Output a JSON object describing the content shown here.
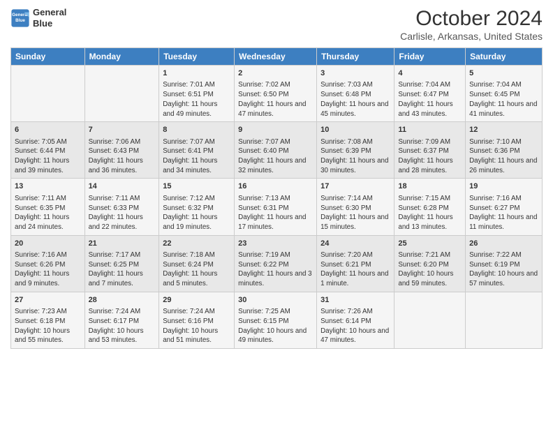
{
  "logo": {
    "line1": "General",
    "line2": "Blue"
  },
  "title": "October 2024",
  "subtitle": "Carlisle, Arkansas, United States",
  "days_of_week": [
    "Sunday",
    "Monday",
    "Tuesday",
    "Wednesday",
    "Thursday",
    "Friday",
    "Saturday"
  ],
  "weeks": [
    [
      {
        "day": "",
        "info": ""
      },
      {
        "day": "",
        "info": ""
      },
      {
        "day": "1",
        "info": "Sunrise: 7:01 AM\nSunset: 6:51 PM\nDaylight: 11 hours and 49 minutes."
      },
      {
        "day": "2",
        "info": "Sunrise: 7:02 AM\nSunset: 6:50 PM\nDaylight: 11 hours and 47 minutes."
      },
      {
        "day": "3",
        "info": "Sunrise: 7:03 AM\nSunset: 6:48 PM\nDaylight: 11 hours and 45 minutes."
      },
      {
        "day": "4",
        "info": "Sunrise: 7:04 AM\nSunset: 6:47 PM\nDaylight: 11 hours and 43 minutes."
      },
      {
        "day": "5",
        "info": "Sunrise: 7:04 AM\nSunset: 6:45 PM\nDaylight: 11 hours and 41 minutes."
      }
    ],
    [
      {
        "day": "6",
        "info": "Sunrise: 7:05 AM\nSunset: 6:44 PM\nDaylight: 11 hours and 39 minutes."
      },
      {
        "day": "7",
        "info": "Sunrise: 7:06 AM\nSunset: 6:43 PM\nDaylight: 11 hours and 36 minutes."
      },
      {
        "day": "8",
        "info": "Sunrise: 7:07 AM\nSunset: 6:41 PM\nDaylight: 11 hours and 34 minutes."
      },
      {
        "day": "9",
        "info": "Sunrise: 7:07 AM\nSunset: 6:40 PM\nDaylight: 11 hours and 32 minutes."
      },
      {
        "day": "10",
        "info": "Sunrise: 7:08 AM\nSunset: 6:39 PM\nDaylight: 11 hours and 30 minutes."
      },
      {
        "day": "11",
        "info": "Sunrise: 7:09 AM\nSunset: 6:37 PM\nDaylight: 11 hours and 28 minutes."
      },
      {
        "day": "12",
        "info": "Sunrise: 7:10 AM\nSunset: 6:36 PM\nDaylight: 11 hours and 26 minutes."
      }
    ],
    [
      {
        "day": "13",
        "info": "Sunrise: 7:11 AM\nSunset: 6:35 PM\nDaylight: 11 hours and 24 minutes."
      },
      {
        "day": "14",
        "info": "Sunrise: 7:11 AM\nSunset: 6:33 PM\nDaylight: 11 hours and 22 minutes."
      },
      {
        "day": "15",
        "info": "Sunrise: 7:12 AM\nSunset: 6:32 PM\nDaylight: 11 hours and 19 minutes."
      },
      {
        "day": "16",
        "info": "Sunrise: 7:13 AM\nSunset: 6:31 PM\nDaylight: 11 hours and 17 minutes."
      },
      {
        "day": "17",
        "info": "Sunrise: 7:14 AM\nSunset: 6:30 PM\nDaylight: 11 hours and 15 minutes."
      },
      {
        "day": "18",
        "info": "Sunrise: 7:15 AM\nSunset: 6:28 PM\nDaylight: 11 hours and 13 minutes."
      },
      {
        "day": "19",
        "info": "Sunrise: 7:16 AM\nSunset: 6:27 PM\nDaylight: 11 hours and 11 minutes."
      }
    ],
    [
      {
        "day": "20",
        "info": "Sunrise: 7:16 AM\nSunset: 6:26 PM\nDaylight: 11 hours and 9 minutes."
      },
      {
        "day": "21",
        "info": "Sunrise: 7:17 AM\nSunset: 6:25 PM\nDaylight: 11 hours and 7 minutes."
      },
      {
        "day": "22",
        "info": "Sunrise: 7:18 AM\nSunset: 6:24 PM\nDaylight: 11 hours and 5 minutes."
      },
      {
        "day": "23",
        "info": "Sunrise: 7:19 AM\nSunset: 6:22 PM\nDaylight: 11 hours and 3 minutes."
      },
      {
        "day": "24",
        "info": "Sunrise: 7:20 AM\nSunset: 6:21 PM\nDaylight: 11 hours and 1 minute."
      },
      {
        "day": "25",
        "info": "Sunrise: 7:21 AM\nSunset: 6:20 PM\nDaylight: 10 hours and 59 minutes."
      },
      {
        "day": "26",
        "info": "Sunrise: 7:22 AM\nSunset: 6:19 PM\nDaylight: 10 hours and 57 minutes."
      }
    ],
    [
      {
        "day": "27",
        "info": "Sunrise: 7:23 AM\nSunset: 6:18 PM\nDaylight: 10 hours and 55 minutes."
      },
      {
        "day": "28",
        "info": "Sunrise: 7:24 AM\nSunset: 6:17 PM\nDaylight: 10 hours and 53 minutes."
      },
      {
        "day": "29",
        "info": "Sunrise: 7:24 AM\nSunset: 6:16 PM\nDaylight: 10 hours and 51 minutes."
      },
      {
        "day": "30",
        "info": "Sunrise: 7:25 AM\nSunset: 6:15 PM\nDaylight: 10 hours and 49 minutes."
      },
      {
        "day": "31",
        "info": "Sunrise: 7:26 AM\nSunset: 6:14 PM\nDaylight: 10 hours and 47 minutes."
      },
      {
        "day": "",
        "info": ""
      },
      {
        "day": "",
        "info": ""
      }
    ]
  ]
}
